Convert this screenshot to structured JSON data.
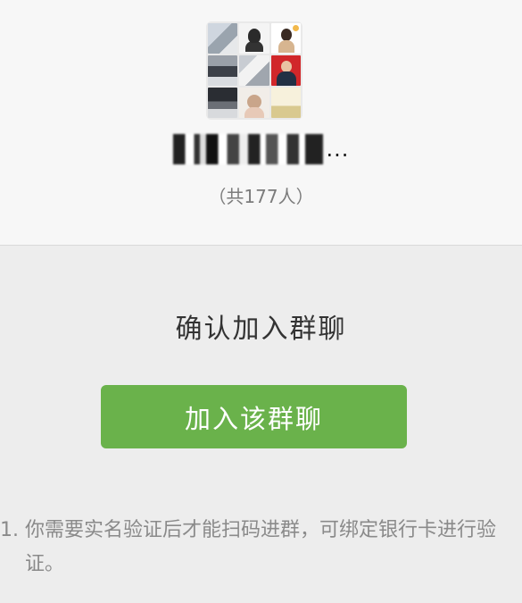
{
  "group": {
    "member_count_text": "（共177人）",
    "name_suffix": "..."
  },
  "confirm": {
    "title": "确认加入群聊",
    "join_button_label": "加入该群聊"
  },
  "notes": [
    {
      "index": "1.",
      "text": "你需要实名验证后才能扫码进群，可绑定银行卡进行验证。"
    }
  ],
  "colors": {
    "button": "#6ab24b",
    "background": "#ededed",
    "header_bg": "#f7f7f7"
  }
}
